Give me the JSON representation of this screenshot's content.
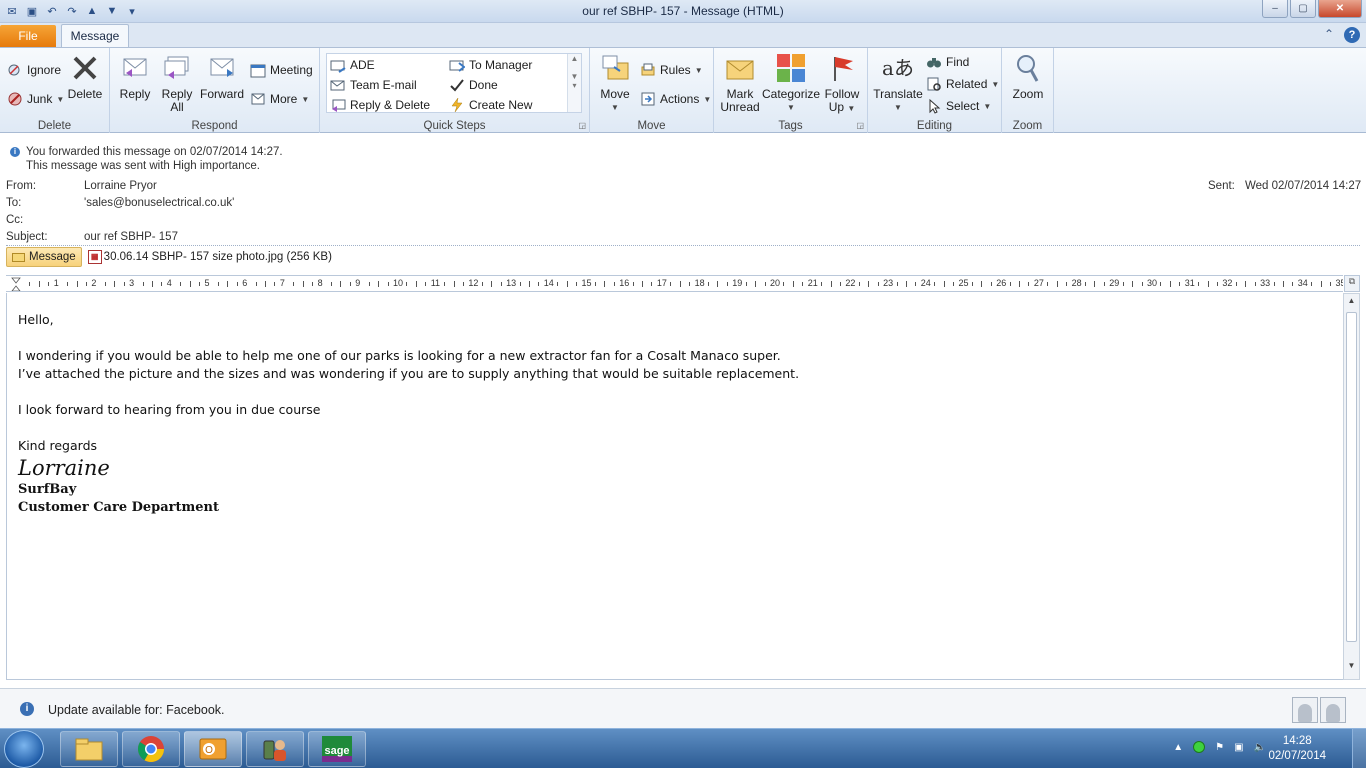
{
  "window": {
    "title": "our ref SBHP- 157  -  Message (HTML)",
    "minimize": "–",
    "maximize": "▢",
    "close": "✕"
  },
  "tabs": {
    "file": "File",
    "message": "Message"
  },
  "ribbon": {
    "delete_group": {
      "label": "Delete",
      "ignore": "Ignore",
      "junk": "Junk",
      "delete": "Delete"
    },
    "respond_group": {
      "label": "Respond",
      "reply": "Reply",
      "reply_all_1": "Reply",
      "reply_all_2": "All",
      "forward": "Forward",
      "meeting": "Meeting",
      "more": "More"
    },
    "quick_steps": {
      "label": "Quick Steps",
      "items": [
        "ADE",
        "To Manager",
        "Team E-mail",
        "Done",
        "Reply & Delete",
        "Create New"
      ]
    },
    "move_group": {
      "label": "Move",
      "move": "Move",
      "rules": "Rules",
      "actions": "Actions"
    },
    "tags_group": {
      "label": "Tags",
      "mark_unread_1": "Mark",
      "mark_unread_2": "Unread",
      "categorize": "Categorize",
      "follow_up_1": "Follow",
      "follow_up_2": "Up"
    },
    "editing_group": {
      "label": "Editing",
      "translate": "Translate",
      "find": "Find",
      "related": "Related",
      "select": "Select"
    },
    "zoom_group": {
      "label": "Zoom",
      "zoom": "Zoom"
    }
  },
  "info": {
    "line1": "You forwarded this message on 02/07/2014 14:27.",
    "line2": "This message was sent with High importance."
  },
  "header": {
    "from_label": "From:",
    "from_value": "Lorraine Pryor",
    "to_label": "To:",
    "to_value": "'sales@bonuselectrical.co.uk'",
    "cc_label": "Cc:",
    "subject_label": "Subject:",
    "subject_value": "our ref SBHP- 157",
    "sent_label": "Sent:",
    "sent_value": "Wed 02/07/2014 14:27"
  },
  "attachments": {
    "message_tab": "Message",
    "file": "30.06.14 SBHP- 157 size  photo.jpg (256 KB)"
  },
  "ruler": {
    "numbers": [
      "1",
      "2",
      "3",
      "4",
      "5",
      "6",
      "7",
      "8",
      "9",
      "10",
      "11",
      "12",
      "13",
      "14",
      "15",
      "16",
      "17",
      "18",
      "19",
      "20",
      "21",
      "22",
      "23",
      "24",
      "25",
      "26",
      "27",
      "28",
      "29",
      "30",
      "31",
      "32",
      "33",
      "34",
      "35"
    ]
  },
  "body": {
    "greeting": "Hello,",
    "para1_line1": "I wondering if you would be able to help me one of our parks is looking for a new extractor fan for a Cosalt Manaco super.",
    "para1_line2": "I’ve  attached the picture and the sizes and was wondering if you are to supply anything that would be suitable replacement.",
    "para2": "I look forward to hearing from you in due course",
    "closing": "Kind regards",
    "sig_name": "Lorraine",
    "sig_company": "SurfBay",
    "sig_dept": "Customer Care Department"
  },
  "status": {
    "text": "Update available for: Facebook."
  },
  "taskbar": {
    "time": "14:28",
    "date": "02/07/2014",
    "sage": "sage"
  },
  "colors": {
    "file_tab": "#e67a0c",
    "accent": "#2f6ab4",
    "taskbar": "#2c5b93"
  }
}
